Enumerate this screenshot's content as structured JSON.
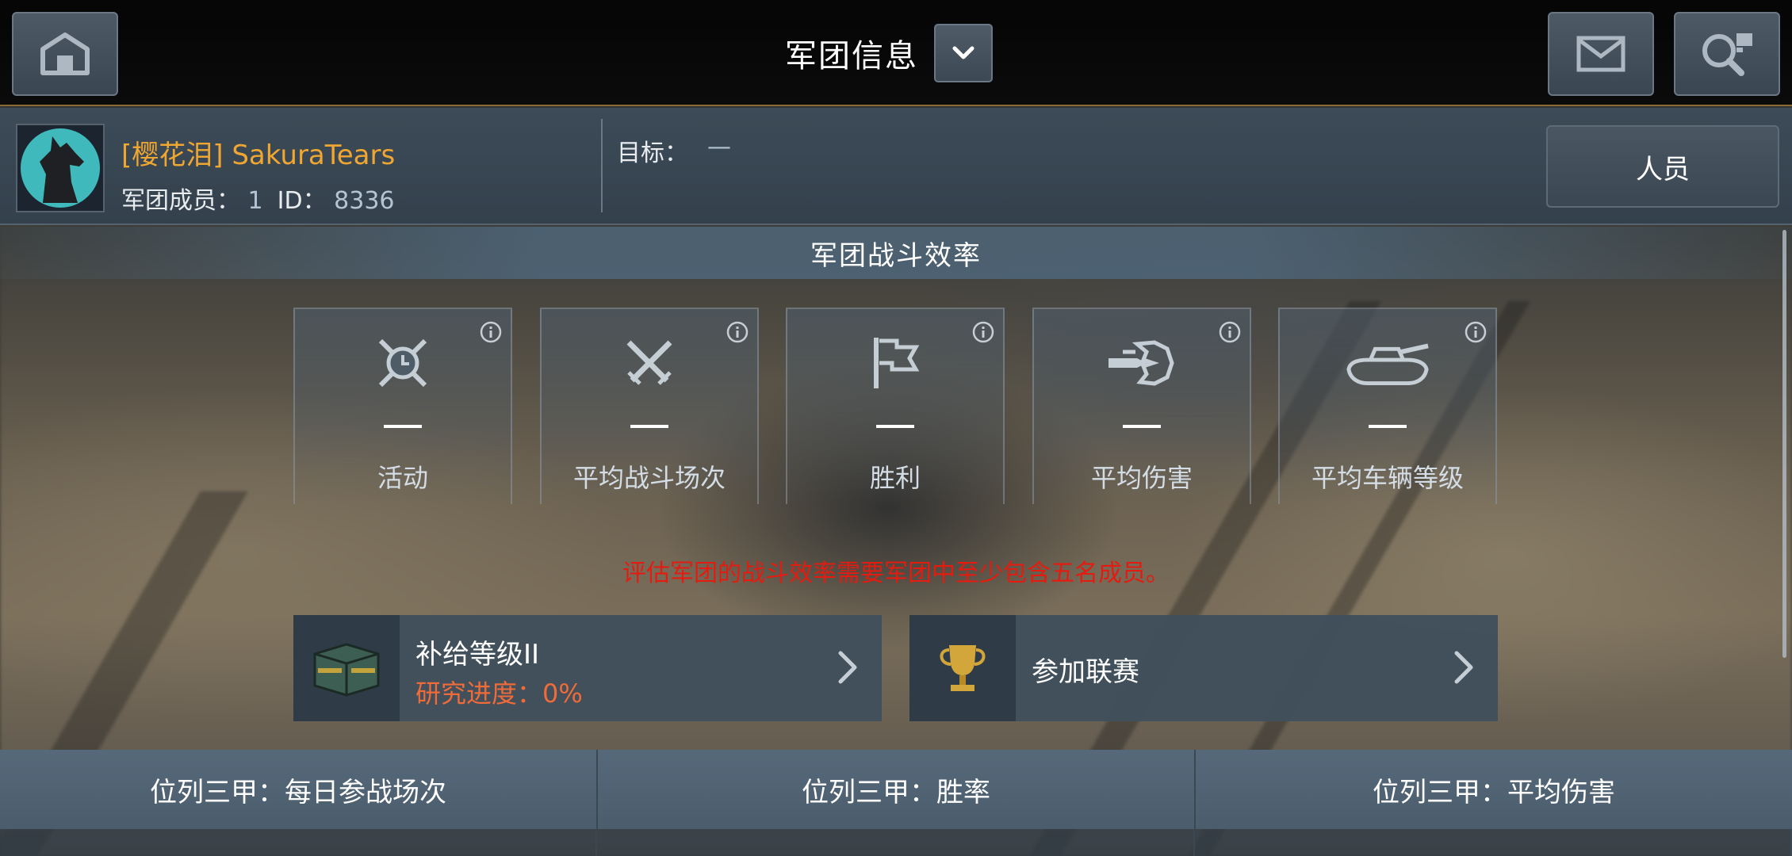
{
  "header": {
    "title": "军团信息",
    "home_icon": "garage-home-icon",
    "mail_icon": "mail-icon",
    "search_icon": "search-clan-icon"
  },
  "clan": {
    "name": "[樱花泪] SakuraTears",
    "members_label": "军团成员：",
    "members_value": "1",
    "id_label": "ID：",
    "id_value": "8336",
    "goal_label": "目标：",
    "goal_value": "—",
    "members_button": "人员"
  },
  "efficiency": {
    "title": "军团战斗效率",
    "cards": [
      {
        "icon": "activity-icon",
        "value": "—",
        "label": "活动"
      },
      {
        "icon": "crossed-swords-icon",
        "value": "—",
        "label": "平均战斗场次"
      },
      {
        "icon": "flag-icon",
        "value": "—",
        "label": "胜利"
      },
      {
        "icon": "shell-damage-icon",
        "value": "—",
        "label": "平均伤害"
      },
      {
        "icon": "tank-icon",
        "value": "—",
        "label": "平均车辆等级"
      }
    ],
    "warning": "评估军团的战斗效率需要军团中至少包含五名成员。"
  },
  "supply": {
    "title": "补给等级II",
    "progress": "研究进度：0%"
  },
  "league": {
    "title": "参加联赛"
  },
  "bottom_tabs": [
    "位列三甲：每日参战场次",
    "位列三甲：胜率",
    "位列三甲：平均伤害"
  ],
  "colors": {
    "clan_name": "#f0a732",
    "warning": "#e51b10",
    "progress": "#f06b3a",
    "accent_line": "#8a6a33"
  }
}
